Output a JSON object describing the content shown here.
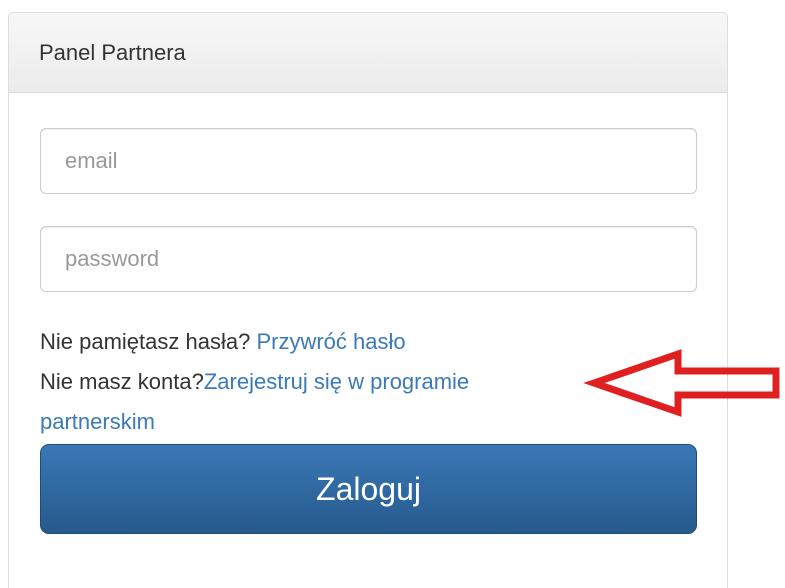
{
  "panel": {
    "title": "Panel Partnera"
  },
  "form": {
    "email_placeholder": "email",
    "password_placeholder": "password",
    "forgot_text": "Nie pamiętasz hasła? ",
    "forgot_link": "Przywróć hasło",
    "no_account_text": "Nie masz konta?",
    "register_link_part1": "Zarejestruj się w programie",
    "register_link_part2": "partnerskim",
    "login_button": "Zaloguj"
  },
  "annotation": {
    "arrow_icon": "left-arrow-icon",
    "arrow_color": "#e02020"
  },
  "colors": {
    "link": "#3b7ab8",
    "button": "#2e6aa5"
  }
}
